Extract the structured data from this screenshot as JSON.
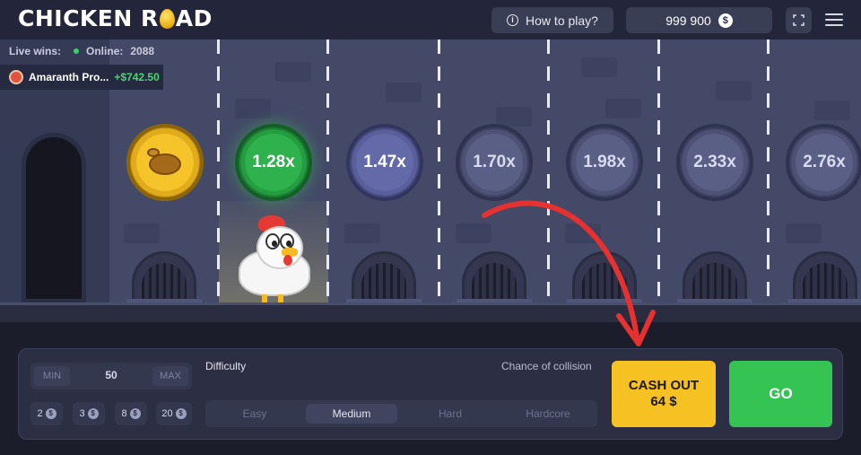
{
  "header": {
    "logo_part1": "CHICKEN R",
    "logo_part2": "AD",
    "how_to_play": "How to play?",
    "balance": "999 900",
    "currency_symbol": "$"
  },
  "live": {
    "live_wins_label": "Live wins:",
    "online_label": "Online:",
    "online_count": "2088",
    "recent_win": {
      "player": "Amaranth Pro...",
      "amount": "+$742.50"
    }
  },
  "lanes": {
    "multipliers": [
      "1.28x",
      "1.47x",
      "1.70x",
      "1.98x",
      "2.33x",
      "2.76x"
    ],
    "current_index": 0
  },
  "controls": {
    "bet_min": "MIN",
    "bet_value": "50",
    "bet_max": "MAX",
    "quick_bets": [
      "2",
      "3",
      "8",
      "20"
    ],
    "difficulty_label": "Difficulty",
    "chance_label": "Chance of collision",
    "difficulties": [
      "Easy",
      "Medium",
      "Hard",
      "Hardcore"
    ],
    "selected_difficulty": "Medium",
    "cashout_title": "CASH OUT",
    "cashout_amount": "64 $",
    "go_label": "GO"
  },
  "colors": {
    "cashout": "#f5c123",
    "go": "#35c453",
    "current_coin": "#2fb14d",
    "win_amount": "#4cd46f"
  }
}
